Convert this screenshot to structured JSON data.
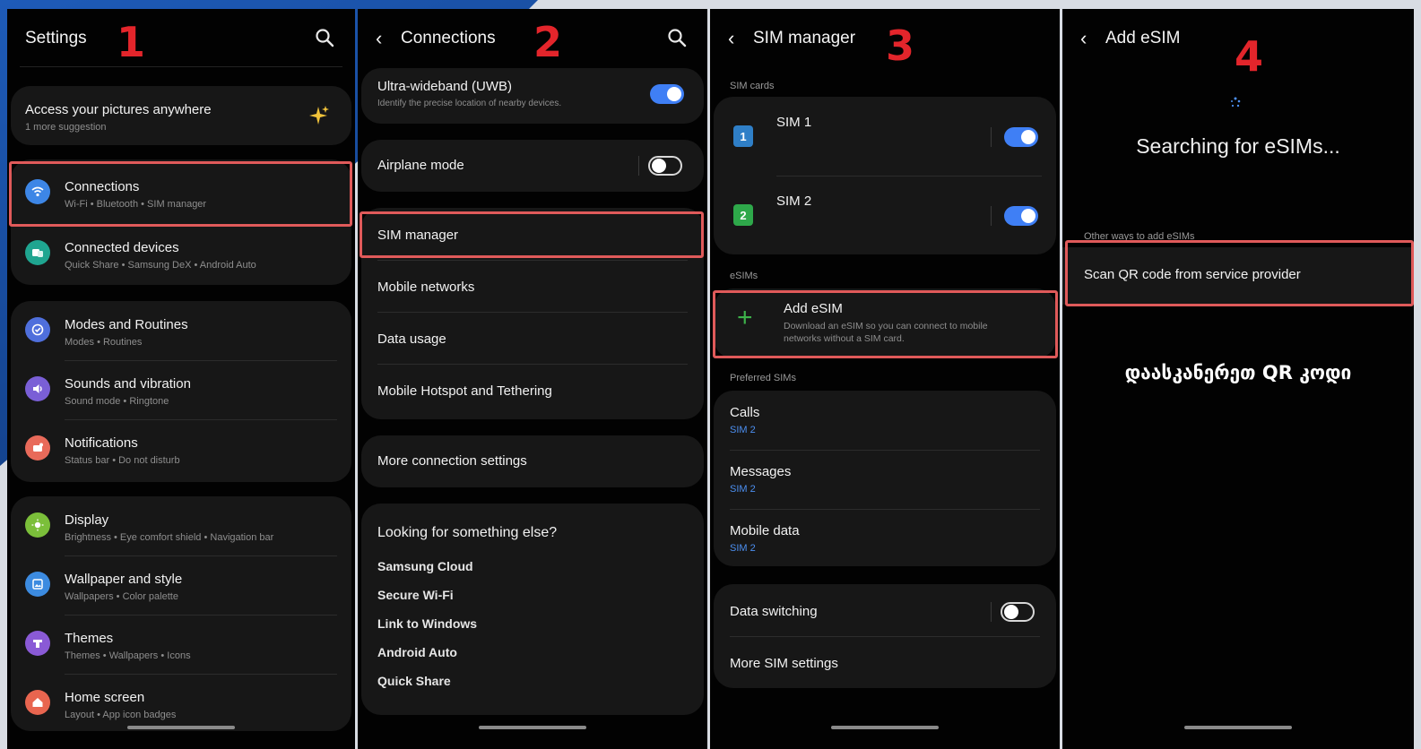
{
  "colors": {
    "accent": "#3f7ff5",
    "highlight": "#e05a5a",
    "step_number": "#e3252b",
    "panel_bg": "#020202",
    "card_bg": "#171717"
  },
  "step1": {
    "number": "1",
    "title": "Settings",
    "suggestion": {
      "title": "Access your pictures anywhere",
      "sub": "1 more suggestion",
      "icon": "sparkle-icon"
    },
    "items": [
      {
        "label": "Connections",
        "sub": "Wi-Fi  •  Bluetooth  •  SIM manager",
        "icon": "wifi-icon",
        "color": "#3d86e6"
      },
      {
        "label": "Connected devices",
        "sub": "Quick Share  •  Samsung DeX  •  Android Auto",
        "icon": "devices-icon",
        "color": "#1fa590"
      },
      {
        "label": "Modes and Routines",
        "sub": "Modes  •  Routines",
        "icon": "modes-icon",
        "color": "#4f6fdc"
      },
      {
        "label": "Sounds and vibration",
        "sub": "Sound mode  •  Ringtone",
        "icon": "sound-icon",
        "color": "#7a5fd6"
      },
      {
        "label": "Notifications",
        "sub": "Status bar  •  Do not disturb",
        "icon": "notification-icon",
        "color": "#e86a5a"
      },
      {
        "label": "Display",
        "sub": "Brightness  •  Eye comfort shield  •  Navigation bar",
        "icon": "display-icon",
        "color": "#7bbf3a"
      },
      {
        "label": "Wallpaper and style",
        "sub": "Wallpapers  •  Color palette",
        "icon": "wallpaper-icon",
        "color": "#3c8be0"
      },
      {
        "label": "Themes",
        "sub": "Themes  •  Wallpapers  •  Icons",
        "icon": "themes-icon",
        "color": "#8a5ad6"
      },
      {
        "label": "Home screen",
        "sub": "Layout  •  App icon badges",
        "icon": "home-icon",
        "color": "#e8654f"
      }
    ]
  },
  "step2": {
    "number": "2",
    "title": "Connections",
    "uwb": {
      "label": "Ultra-wideband (UWB)",
      "sub": "Identify the precise location of nearby devices.",
      "state": "on"
    },
    "airplane": {
      "label": "Airplane mode",
      "state": "off"
    },
    "items": [
      "SIM manager",
      "Mobile networks",
      "Data usage",
      "Mobile Hotspot and Tethering"
    ],
    "more": "More connection settings",
    "looking": {
      "title": "Looking for something else?",
      "links": [
        "Samsung Cloud",
        "Secure Wi-Fi",
        "Link to Windows",
        "Android Auto",
        "Quick Share"
      ]
    }
  },
  "step3": {
    "number": "3",
    "title": "SIM manager",
    "sim_cards_label": "SIM cards",
    "sims": [
      {
        "badge": "1",
        "label": "SIM 1",
        "color": "#2f7fc7",
        "state": "on"
      },
      {
        "badge": "2",
        "label": "SIM 2",
        "color": "#2ea84a",
        "state": "on"
      }
    ],
    "esims_label": "eSIMs",
    "add_esim": {
      "label": "Add eSIM",
      "sub1": "Download an eSIM so you can connect to mobile",
      "sub2": "networks without a SIM card."
    },
    "preferred_label": "Preferred SIMs",
    "preferred": [
      {
        "label": "Calls",
        "value": "SIM 2"
      },
      {
        "label": "Messages",
        "value": "SIM 2"
      },
      {
        "label": "Mobile data",
        "value": "SIM 2"
      }
    ],
    "data_switching": {
      "label": "Data switching",
      "state": "off"
    },
    "more": "More SIM settings"
  },
  "step4": {
    "number": "4",
    "title": "Add eSIM",
    "searching": "Searching for eSIMs...",
    "other_ways": "Other ways to add eSIMs",
    "scan": "Scan QR code from service provider",
    "caption": "დაასკანერეთ QR კოდი"
  }
}
